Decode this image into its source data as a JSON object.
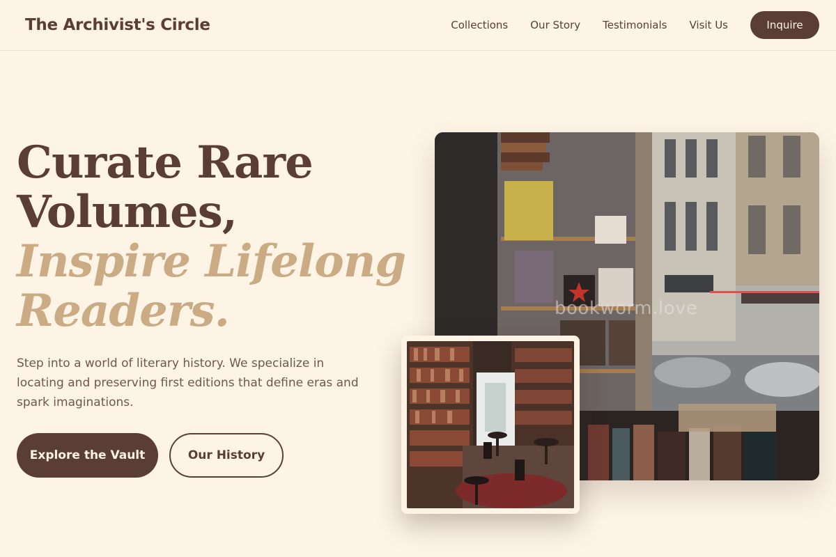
{
  "header": {
    "brand": "The Archivist's Circle",
    "nav": [
      "Collections",
      "Our Story",
      "Testimonials",
      "Visit Us"
    ],
    "cta": "Inquire"
  },
  "hero": {
    "title_line1": "Curate Rare",
    "title_line2": "Volumes,",
    "title_line3": "Inspire Lifelong",
    "title_line4": "Readers.",
    "description": "Step into a world of literary history. We specialize in locating and preserving first editions that define eras and spark imaginations.",
    "primary_button": "Explore the Vault",
    "secondary_button": "Our History"
  },
  "images": {
    "main_watermark": "bookworm.love",
    "main_icon": "bookshop-storefront-photo",
    "inset_icon": "library-cafe-photo"
  },
  "colors": {
    "background": "#fdf4e6",
    "brand_brown": "#5a3d34",
    "accent_tan": "#cbab84",
    "body_text": "#6f574d"
  }
}
